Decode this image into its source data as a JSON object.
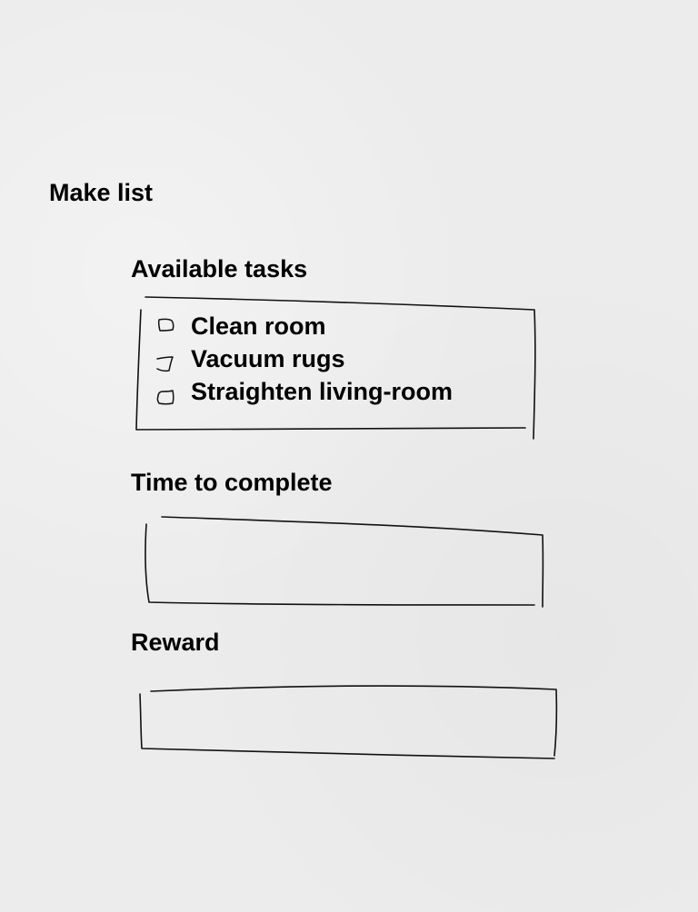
{
  "page": {
    "title": "Make list"
  },
  "tasks": {
    "label": "Available tasks",
    "items": [
      {
        "label": "Clean room"
      },
      {
        "label": "Vacuum rugs"
      },
      {
        "label": "Straighten living-room"
      }
    ]
  },
  "time_to_complete": {
    "label": "Time to complete",
    "value": ""
  },
  "reward": {
    "label": "Reward",
    "value": ""
  },
  "colors": {
    "ink": "#111111",
    "paper": "#ececec"
  }
}
